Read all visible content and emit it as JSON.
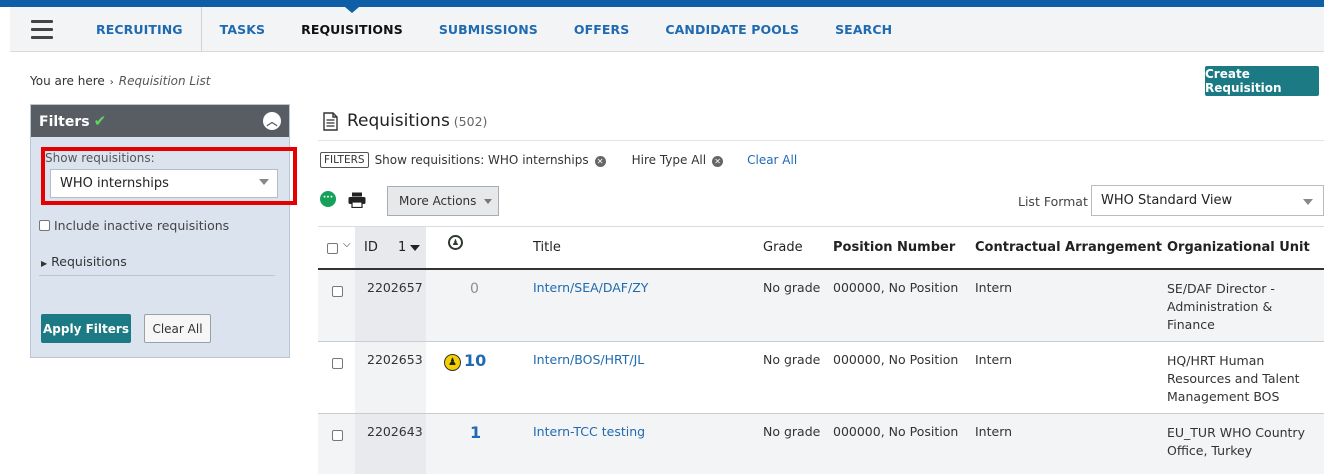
{
  "nav": {
    "items": [
      "RECRUITING",
      "TASKS",
      "REQUISITIONS",
      "SUBMISSIONS",
      "OFFERS",
      "CANDIDATE POOLS",
      "SEARCH"
    ],
    "active": "REQUISITIONS"
  },
  "breadcrumb": {
    "prefix": "You are here",
    "current": "Requisition List"
  },
  "create_button": "Create Requisition",
  "filters": {
    "title": "Filters",
    "show_label": "Show requisitions:",
    "show_value": "WHO internships",
    "include_inactive": "Include inactive requisitions",
    "requisitions_toggle": "Requisitions",
    "apply": "Apply Filters",
    "clear": "Clear All"
  },
  "main": {
    "title": "Requisitions",
    "count": "(502)",
    "filter_tag": "FILTERS",
    "applied_filter_1": "Show requisitions: WHO internships",
    "applied_filter_2": "Hire Type All",
    "clear_all": "Clear All",
    "more_actions": "More Actions",
    "list_format_label": "List Format",
    "list_format_value": "WHO Standard View"
  },
  "table": {
    "headers": {
      "id": "ID",
      "id_sort": "1",
      "title": "Title",
      "grade": "Grade",
      "position": "Position Number",
      "contract": "Contractual Arrangement",
      "org": "Organizational Unit"
    },
    "rows": [
      {
        "id": "2202657",
        "submissions": "0",
        "title": "Intern/SEA/DAF/ZY",
        "grade": "No grade",
        "position": "000000, No Position",
        "contract": "Intern",
        "org_lines": [
          "SE/DAF Director -",
          "Administration &",
          "Finance"
        ]
      },
      {
        "id": "2202653",
        "submissions": "10",
        "title": "Intern/BOS/HRT/JL",
        "grade": "No grade",
        "position": "000000, No Position",
        "contract": "Intern",
        "org_lines": [
          "HQ/HRT Human",
          "Resources and Talent",
          "Management BOS"
        ]
      },
      {
        "id": "2202643",
        "submissions": "1",
        "title": "Intern-TCC testing",
        "grade": "No grade",
        "position": "000000, No Position",
        "contract": "Intern",
        "org_lines": [
          "EU_TUR WHO Country",
          "Office, Turkey"
        ]
      }
    ]
  },
  "colors": {
    "brand_blue": "#0f5fa8",
    "teal_button": "#1b7a83",
    "link": "#1f6ab0",
    "highlight_red": "#e60000"
  }
}
